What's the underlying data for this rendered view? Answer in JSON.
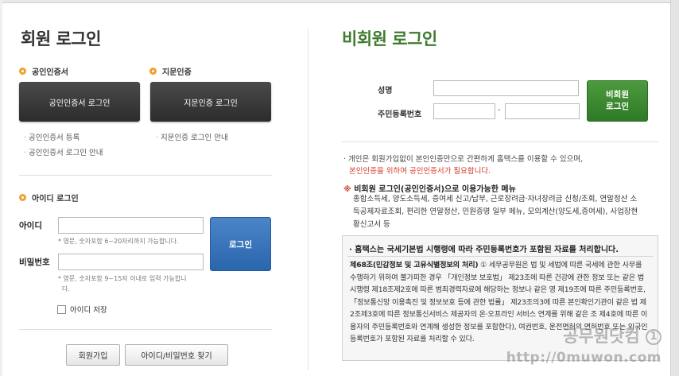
{
  "member_login": {
    "title": "회원 로그인",
    "cert_section": {
      "title": "공인인증서",
      "button": "공인인증서 로그인",
      "links": [
        "공인인증서 등록",
        "공인인증서 로그인 안내"
      ]
    },
    "finger_section": {
      "title": "지문인증",
      "button": "지문인증 로그인",
      "links": [
        "지문인증 로그인 안내"
      ]
    },
    "id_section": {
      "title": "아이디 로그인",
      "id_label": "아이디",
      "id_value": "",
      "id_hint": "영문, 숫자포함 6~20자리까지 가능합니다.",
      "pw_label": "비밀번호",
      "pw_value": "",
      "pw_hint_line1": "영문, 숫자포함 9~15자 이내로 입력 가능합니",
      "pw_hint_line2": "다.",
      "save_id_label": "아이디 저장",
      "login_button": "로그인"
    },
    "join_button": "회원가입",
    "find_button": "아이디/비밀번호 찾기"
  },
  "guest_login": {
    "title": "비회원 로그인",
    "name_label": "성명",
    "name_value": "",
    "rrn_label": "주민등록번호",
    "rrn_front": "",
    "rrn_dash": "-",
    "rrn_back": "",
    "button_line1": "비회원",
    "button_line2": "로그인",
    "notice_line1": "개인은 회원가입없이 본인인증만으로 간편하게 홈택스를 이용할 수 있으며,",
    "notice_line2": "본인인증을 위하여 공인인증서가 필요합니다.",
    "menu_title_star": "※",
    "menu_title": "비회원 로그인(공인인증서)으로 이용가능한 메뉴",
    "menu_text": "종합소득세, 양도소득세, 증여세 신고/납부, 근로장려금·자녀장려금 신청/조회, 연말정산 소득공제자료조회, 편리한 연말정산, 민원증명 일부 메뉴, 모의계산(양도세,증여세), 사업장현황신고서 등",
    "info_title": "홈택스는 국세기본법 시행령에 따라 주민등록번호가 포함된 자료를 처리합니다.",
    "info_bold": "제68조(민감정보 및 고유식별정보의 처리)",
    "info_body": "① 세무공무원은 법 및 세법에 따른 국세에 관한 사무를 수행하기 위하여 불가피한 경우 「개인정보 보호법」 제23조에 따른 건강에 관한 정보 또는 같은 법 시행령 제18조제2호에 따른 범죄경력자료에 해당하는 정보나 같은 영 제19조에 따른 주민등록번호,「정보통신망 이용촉진 및 정보보호 등에 관한 법률」 제23조의3에 따른 본인확인기관이 같은 법 제2조제3호에 따른 정보통신서비스 제공자의 온·오프라인 서비스 연계를 위해 같은 조 제4호에 따른 이용자의 주민등록번호와 연계해 생성한 정보를 포함한다), 여권번호, 운전면허의 면허번호 또는 외국인등록번호가 포함된 자료를 처리할 수 있다."
  },
  "watermark": {
    "text": "공무원닷컴",
    "circle": "1",
    "url": "http://0muwon.com"
  },
  "colors": {
    "accent_orange": "#f0a030",
    "guest_green": "#3f7b2d",
    "login_blue": "#2a66ad",
    "notice_red": "#d43a2a"
  }
}
